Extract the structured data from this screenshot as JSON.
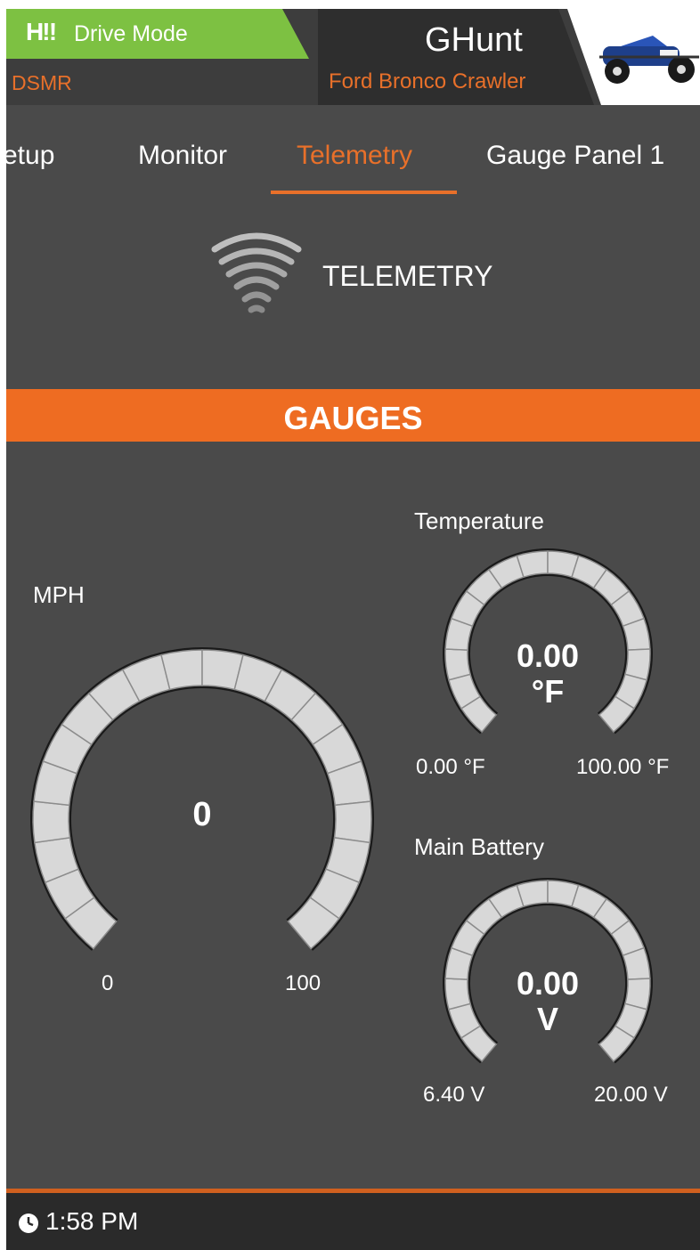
{
  "header": {
    "drive_mode_icon": "H‼",
    "drive_mode_label": "Drive Mode",
    "model_type": "DSMR",
    "model_name": "GHunt",
    "vehicle_name": "Ford Bronco Crawler"
  },
  "tabs": {
    "items": [
      "etup",
      "Monitor",
      "Telemetry",
      "Gauge Panel 1"
    ],
    "active": "Telemetry"
  },
  "telemetry": {
    "title": "TELEMETRY"
  },
  "gauges": {
    "banner": "GAUGES",
    "mph": {
      "label": "MPH",
      "value": "0",
      "min": "0",
      "max": "100"
    },
    "temperature": {
      "label": "Temperature",
      "value": "0.00",
      "unit": "°F",
      "min": "0.00 °F",
      "max": "100.00 °F"
    },
    "battery": {
      "label": "Main Battery",
      "value": "0.00",
      "unit": "V",
      "min": "6.40 V",
      "max": "20.00 V"
    }
  },
  "footer": {
    "time": "1:58 PM"
  },
  "colors": {
    "accent": "#ee6c22",
    "drive_mode": "#7dc142",
    "background": "#4a4a4a"
  }
}
